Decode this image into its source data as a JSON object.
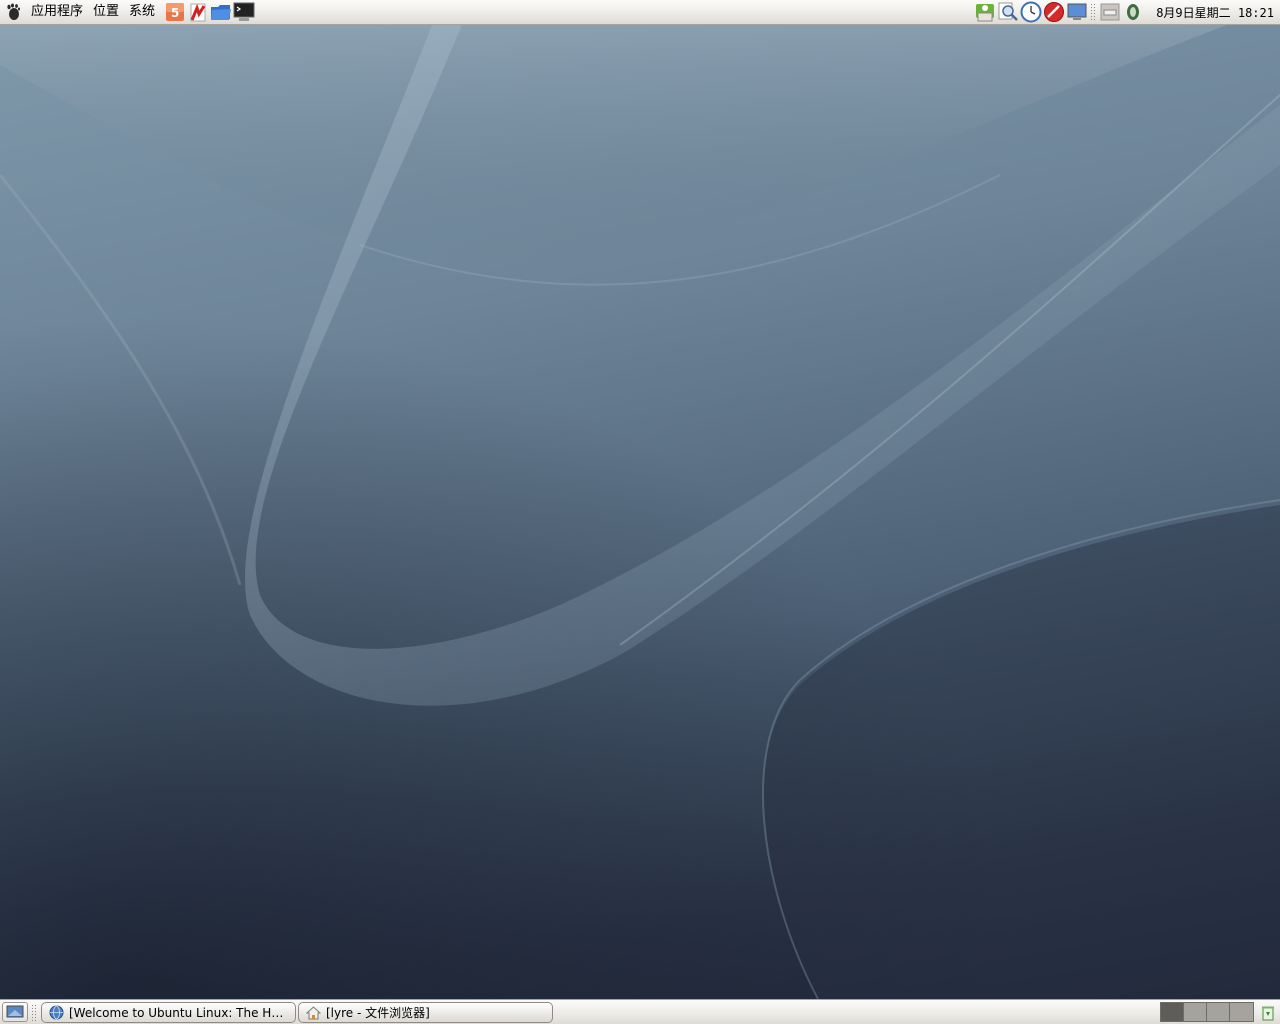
{
  "top_panel": {
    "menus": {
      "applications": "应用程序",
      "places": "位置",
      "system": "系统"
    },
    "launchers": [
      "firefox-launcher",
      "pdf-reader-launcher",
      "file-manager-launcher",
      "terminal-launcher"
    ],
    "tray": [
      "update-notifier",
      "search-tool",
      "clock-applet",
      "stop-button",
      "display-monitor",
      "keyboard-indicator",
      "volume-indicator"
    ],
    "clock": "8月9日星期二 18:21"
  },
  "bottom_panel": {
    "tasks": [
      {
        "label": "[Welcome to Ubuntu Linux: The Hoa…",
        "icon": "globe-icon"
      },
      {
        "label": "[lyre - 文件浏览器]",
        "icon": "home-folder-icon"
      }
    ],
    "workspaces": 4,
    "active_workspace": 1
  },
  "colors": {
    "panel": "#eceae6",
    "desktop_light": "#7f98aa",
    "desktop_dark": "#1e2537"
  }
}
